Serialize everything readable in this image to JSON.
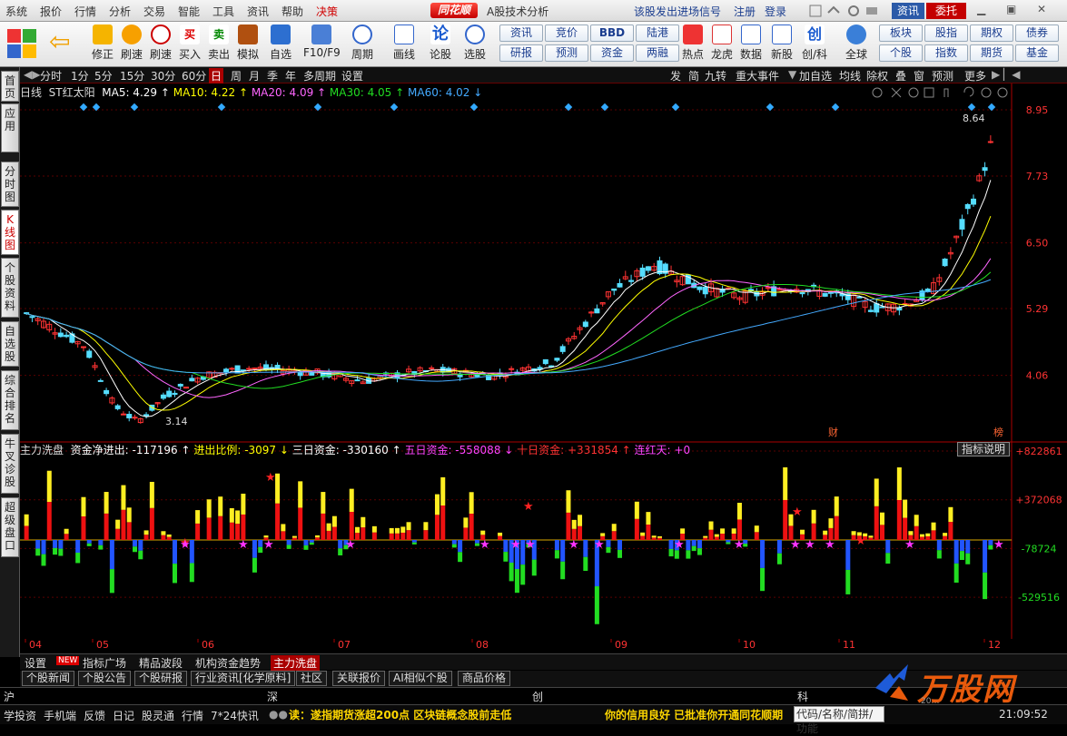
{
  "menubar": {
    "items": [
      "系统",
      "报价",
      "行情",
      "分析",
      "交易",
      "智能",
      "工具",
      "资讯",
      "帮助",
      "决策"
    ],
    "logo": "同花顺",
    "title": "A股技术分析",
    "signal": "该股发出进场信号",
    "register": "注册",
    "login": "登录",
    "btn_news": "资讯",
    "btn_entrust": "委托"
  },
  "toolbar": {
    "buttons": [
      "修正",
      "刷速",
      "买入",
      "卖出",
      "模拟",
      "自选",
      "F10/F9",
      "周期",
      "画线",
      "论股",
      "选股"
    ],
    "grid_buttons": [
      "资讯",
      "竞价",
      "BBD",
      "陆港",
      "研报",
      "预测",
      "资金",
      "两融"
    ],
    "icons": [
      "热点",
      "龙虎",
      "数据",
      "新股",
      "创/科",
      "全球"
    ],
    "right_buttons": [
      "板块",
      "股指",
      "期权",
      "债券",
      "个股",
      "指数",
      "期货",
      "基金"
    ]
  },
  "left_tabs": [
    "首页",
    "应用",
    "分时图",
    "K线图",
    "个股资料",
    "自选股",
    "综合排名",
    "牛叉诊股",
    "超级盘口"
  ],
  "period_bar": {
    "items": [
      "分时",
      "1分",
      "5分",
      "15分",
      "30分",
      "60分",
      "日",
      "周",
      "月",
      "季",
      "年",
      "多周期",
      "设置"
    ],
    "active": "日",
    "right": [
      "发",
      "简",
      "九转",
      "重大事件",
      "加自选",
      "均线",
      "除权",
      "叠",
      "窗",
      "预测",
      "更多"
    ]
  },
  "kline": {
    "label": "日线",
    "stock": "ST红太阳",
    "ma": [
      {
        "name": "MA5",
        "value": "4.29",
        "color": "#ffffff"
      },
      {
        "name": "MA10",
        "value": "4.22",
        "color": "#ffff00"
      },
      {
        "name": "MA20",
        "value": "4.09",
        "color": "#ff66ff"
      },
      {
        "name": "MA30",
        "value": "4.05",
        "color": "#22dd22"
      },
      {
        "name": "MA60",
        "value": "4.02",
        "color": "#44aaff"
      }
    ],
    "axis_labels": [
      "8.95",
      "7.73",
      "6.50",
      "5.29",
      "4.06"
    ],
    "high_label": "8.64",
    "low_label": "3.14",
    "event_marks": [
      "财",
      "榜"
    ]
  },
  "indicator": {
    "name": "主力洗盘",
    "fields": [
      {
        "label": "资金净进出:",
        "value": "-117196",
        "arrow": "↑",
        "color": "#ffffff"
      },
      {
        "label": "进出比例:",
        "value": "-3097",
        "arrow": "↓",
        "color": "#ffff00"
      },
      {
        "label": "三日资金:",
        "value": "-330160",
        "arrow": "↑",
        "color": "#ffffff"
      },
      {
        "label": "五日资金:",
        "value": "-558088",
        "arrow": "↓",
        "color": "#ff44ff"
      },
      {
        "label": "十日资金:",
        "value": "+331854",
        "arrow": "↑",
        "color": "#ff3333"
      },
      {
        "label": "连红天:",
        "value": "+0",
        "arrow": "",
        "color": "#ff44ff"
      }
    ],
    "explain": "指标说明",
    "axis_labels": [
      "+822861",
      "+372068",
      "-78724",
      "-529516"
    ]
  },
  "xaxis": [
    "04",
    "05",
    "06",
    "07",
    "08",
    "09",
    "10",
    "11",
    "12"
  ],
  "bottom_tabs1": {
    "items": [
      "设置",
      "指标广场",
      "精品波段",
      "机构资金趋势",
      "主力洗盘"
    ],
    "new_badge": "NEW",
    "active": "主力洗盘"
  },
  "bottom_tabs2": [
    "个股新闻",
    "个股公告",
    "个股研报",
    "行业资讯[化学原料]",
    "社区",
    "关联报价",
    "AI相似个股",
    "商品价格"
  ],
  "index_bar": [
    "沪",
    "深",
    "创",
    "科"
  ],
  "status": {
    "items": [
      "学投资",
      "手机端",
      "反馈",
      "日记",
      "股灵通",
      "行情",
      "7*24快讯"
    ],
    "ticker": "读：遂指期货涨超200点  区块链概念股前走低",
    "ticker2": "你的信用良好 已批准你开通同花顺期",
    "search": "代码/名称/简拼/功能",
    "clock": "21:09:52"
  },
  "watermark": {
    "text": "万股网",
    "url": "20…"
  },
  "chart_data": {
    "type": "candlestick",
    "xlim": [
      0,
      100
    ],
    "ylim": [
      3.0,
      9.1
    ]
  }
}
